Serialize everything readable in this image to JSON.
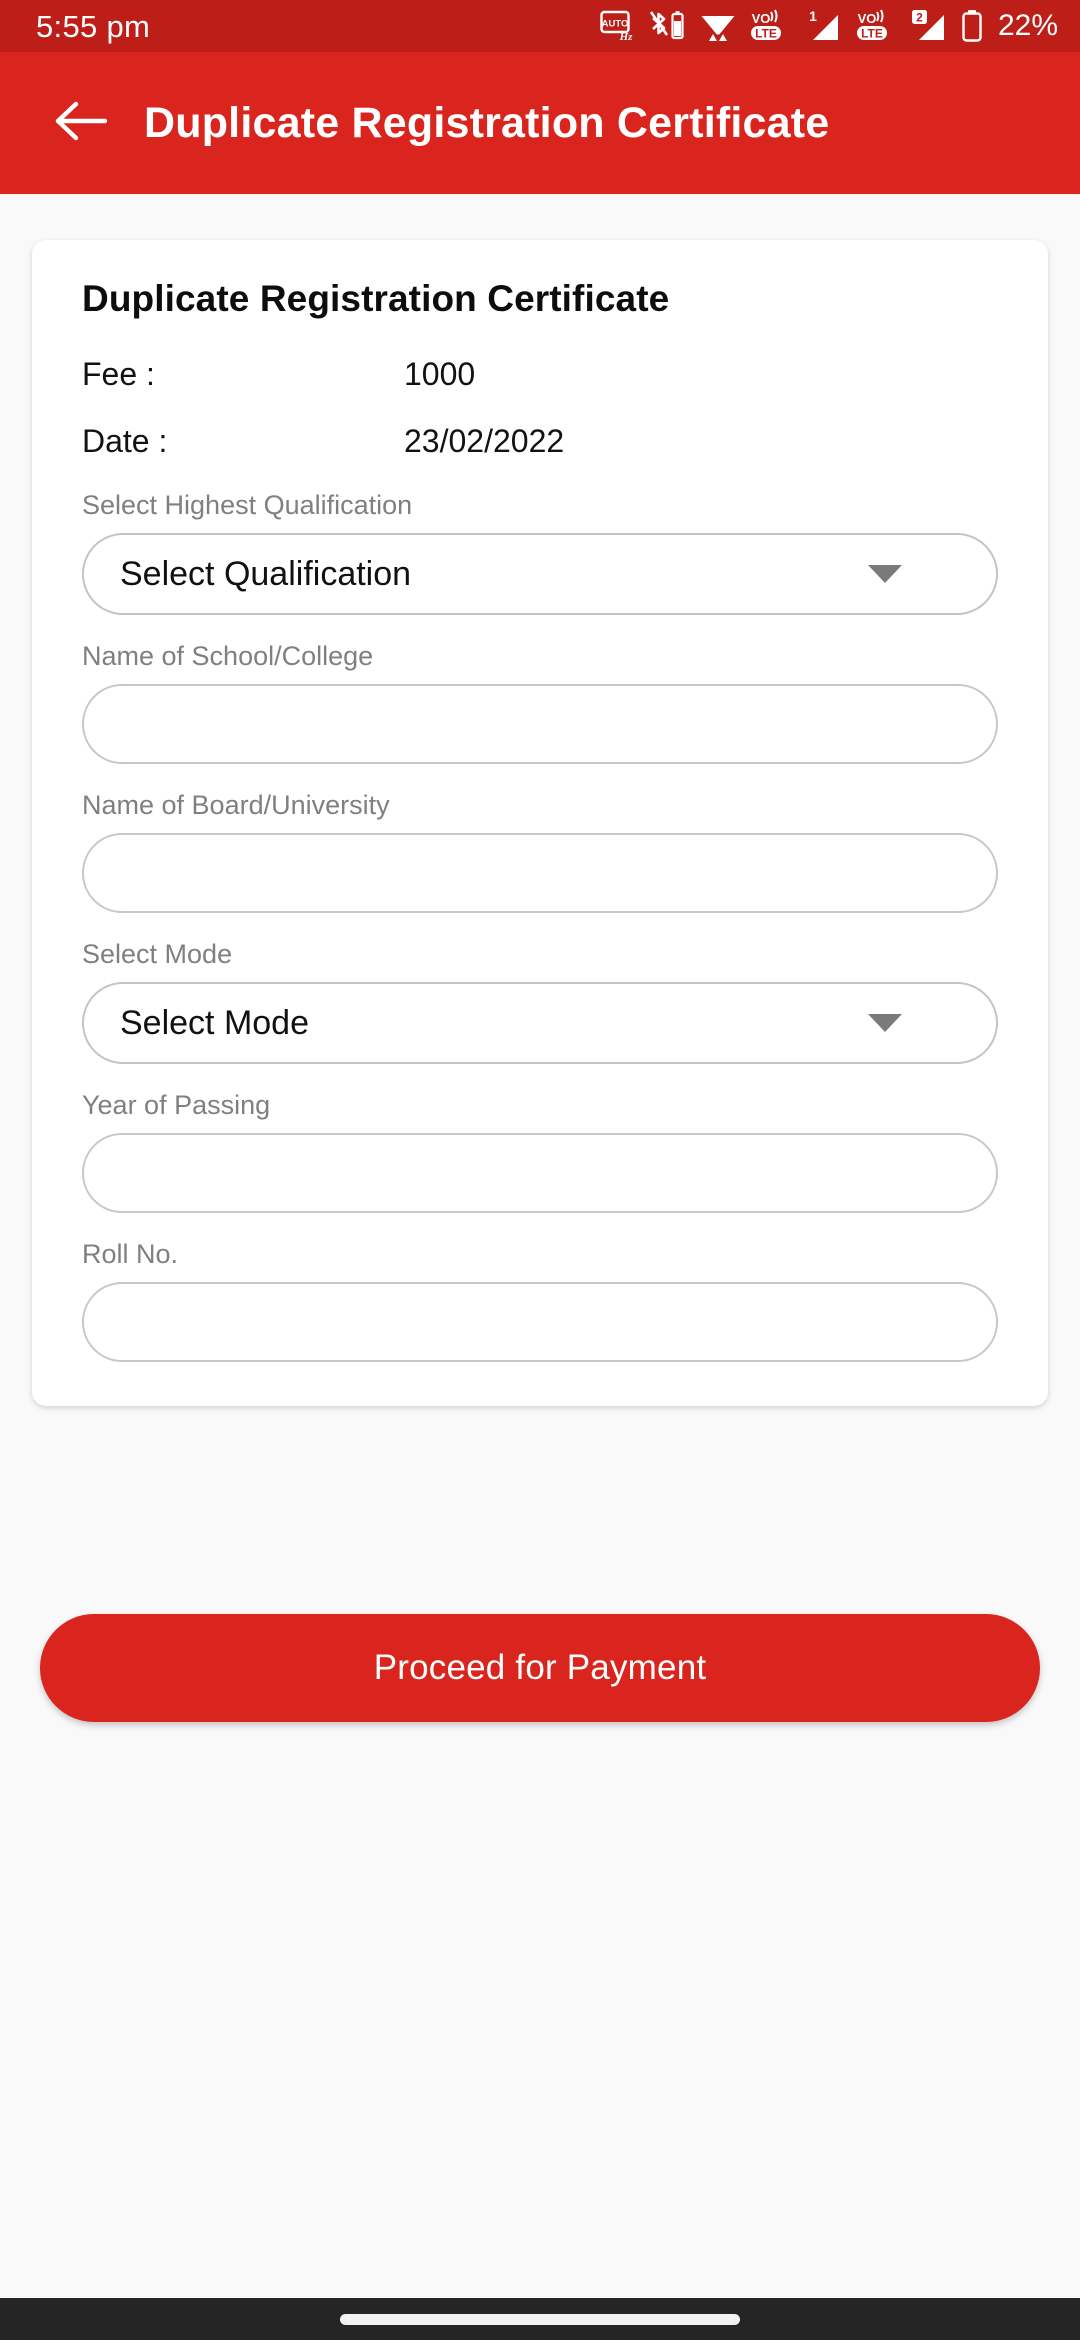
{
  "status_bar": {
    "time": "5:55 pm",
    "battery_percent": "22%",
    "icons": [
      {
        "name": "auto-refresh-rate-icon",
        "label": "AUTO Hz"
      },
      {
        "name": "bluetooth-battery-icon",
        "label": "Bluetooth device battery"
      },
      {
        "name": "wifi-icon",
        "label": "Wi-Fi"
      },
      {
        "name": "volte-sim1-icon",
        "label": "VoLTE"
      },
      {
        "name": "signal-sim1-icon",
        "label": "1"
      },
      {
        "name": "volte-sim2-icon",
        "label": "VoLTE"
      },
      {
        "name": "signal-sim2-icon",
        "label": "2"
      },
      {
        "name": "battery-icon",
        "label": "Battery"
      }
    ],
    "sim1_label": "1",
    "sim2_label": "2",
    "background_color": "#bd1e17"
  },
  "app_bar": {
    "title": "Duplicate Registration Certificate",
    "back_icon": "arrow-left-icon",
    "background_color": "#d9251d"
  },
  "card": {
    "title": "Duplicate Registration Certificate",
    "details": [
      {
        "key": "Fee :",
        "value": "1000"
      },
      {
        "key": "Date :",
        "value": "23/02/2022"
      }
    ],
    "fields": [
      {
        "label": "Select Highest Qualification",
        "type": "select",
        "value": "Select Qualification",
        "caret_icon": "chevron-down-icon"
      },
      {
        "label": "Name of School/College",
        "type": "text",
        "value": "",
        "placeholder": ""
      },
      {
        "label": "Name of Board/University",
        "type": "text",
        "value": "",
        "placeholder": ""
      },
      {
        "label": "Select Mode",
        "type": "select",
        "value": "Select Mode",
        "caret_icon": "chevron-down-icon"
      },
      {
        "label": "Year of Passing",
        "type": "text",
        "value": "",
        "placeholder": ""
      },
      {
        "label": "Roll No.",
        "type": "text",
        "value": "",
        "placeholder": ""
      }
    ]
  },
  "primary_button": {
    "label": "Proceed for Payment",
    "color": "#d9251d"
  },
  "nav_bar": {
    "gesture_pill": "home-gesture-pill",
    "background_color": "#252525"
  }
}
